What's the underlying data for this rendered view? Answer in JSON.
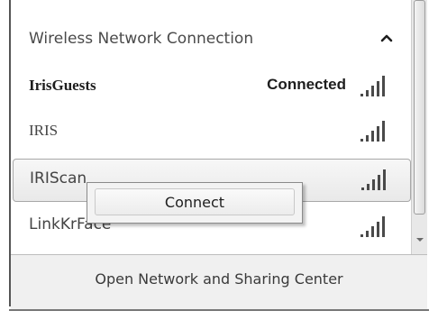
{
  "section": {
    "title": "Wireless Network Connection",
    "collapse_icon": "chevron-up-icon"
  },
  "networks": [
    {
      "name": "IrisGuests",
      "status": "Connected",
      "signal_bars": 5
    },
    {
      "name": "IRIS",
      "status": "",
      "signal_bars": 5
    },
    {
      "name": "IRIScan",
      "status": "",
      "signal_bars": 5
    },
    {
      "name": "LinkKrFace",
      "status": "",
      "signal_bars": 5
    }
  ],
  "context_menu": {
    "connect_label": "Connect"
  },
  "footer": {
    "link_label": "Open Network and Sharing Center"
  },
  "colors": {
    "signal": "#4a4a4a",
    "highlight_border": "#a8a8a8"
  }
}
